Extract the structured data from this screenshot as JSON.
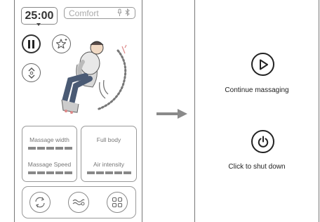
{
  "left_screen": {
    "timer": "25:00",
    "mode": "Comfort",
    "controls": {
      "width_label": "Massage width",
      "speed_label": "Massage Speed",
      "body_label": "Full body",
      "air_label": "Air intensity"
    },
    "icons": [
      "pause-icon",
      "star-sparkle-icon",
      "recline-icon",
      "mic-icon",
      "bluetooth-icon",
      "swap-icon",
      "wave-massage-icon",
      "grid-icon"
    ]
  },
  "right_screen": {
    "continue_label": "Continue massaging",
    "shutdown_label": "Click to shut down"
  },
  "colors": {
    "outline": "#888888",
    "accent": "#222222"
  }
}
